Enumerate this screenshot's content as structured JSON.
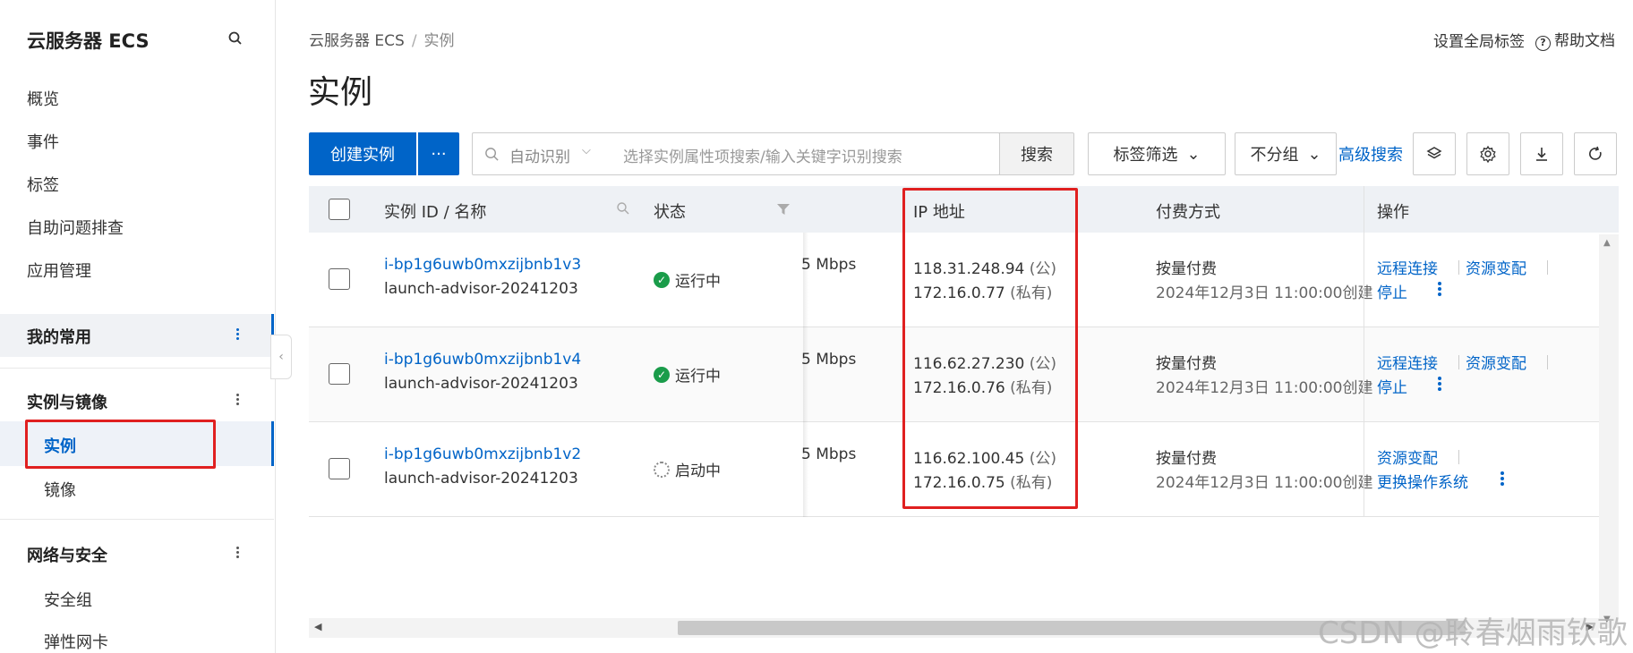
{
  "sidebar": {
    "title": "云服务器 ECS",
    "items": [
      "概览",
      "事件",
      "标签",
      "自助问题排查",
      "应用管理"
    ],
    "favorites_label": "我的常用",
    "group_instances": "实例与镜像",
    "sub_instances": "实例",
    "sub_images": "镜像",
    "group_network": "网络与安全",
    "sub_security_group": "安全组",
    "sub_eni": "弹性网卡"
  },
  "breadcrumb": {
    "root": "云服务器 ECS",
    "sep": "/",
    "current": "实例"
  },
  "topbar": {
    "global_tags": "设置全局标签",
    "help_icon": "?",
    "help": "帮助文档"
  },
  "page_title": "实例",
  "toolbar": {
    "create": "创建实例",
    "more": "···",
    "search_scope": "自动识别",
    "search_scope_chev": "⌵",
    "search_placeholder": "选择实例属性项搜索/输入关键字识别搜索",
    "search_btn": "搜索",
    "tag_filter": "标签筛选",
    "group_select": "不分组",
    "advanced_search": "高级搜索"
  },
  "table": {
    "headers": {
      "id_name": "实例 ID / 名称",
      "status": "状态",
      "ip": "IP 地址",
      "billing": "付费方式",
      "ops": "操作"
    },
    "rows": [
      {
        "id": "i-bp1g6uwb0mxzijbnb1v3",
        "name": "launch-advisor-20241203",
        "status": "运行中",
        "status_icon": "✓",
        "bandwidth": "5 Mbps",
        "ip_public": "118.31.248.94",
        "ip_public_tag": "(公)",
        "ip_private": "172.16.0.77",
        "ip_private_tag": "(私有)",
        "billing": "按量付费",
        "created": "2024年12月3日 11:00:00创建",
        "op1": "远程连接",
        "op2": "资源变配",
        "op3": "停止"
      },
      {
        "id": "i-bp1g6uwb0mxzijbnb1v4",
        "name": "launch-advisor-20241203",
        "status": "运行中",
        "status_icon": "✓",
        "bandwidth": "5 Mbps",
        "ip_public": "116.62.27.230",
        "ip_public_tag": "(公)",
        "ip_private": "172.16.0.76",
        "ip_private_tag": "(私有)",
        "billing": "按量付费",
        "created": "2024年12月3日 11:00:00创建",
        "op1": "远程连接",
        "op2": "资源变配",
        "op3": "停止"
      },
      {
        "id": "i-bp1g6uwb0mxzijbnb1v2",
        "name": "launch-advisor-20241203",
        "status": "启动中",
        "bandwidth": "5 Mbps",
        "ip_public": "116.62.100.45",
        "ip_public_tag": "(公)",
        "ip_private": "172.16.0.75",
        "ip_private_tag": "(私有)",
        "billing": "按量付费",
        "created": "2024年12月3日 11:00:00创建",
        "op1": "资源变配",
        "op2": "更换操作系统"
      }
    ]
  },
  "ui": {
    "collapse_chevron": "‹",
    "scroll_up": "▲",
    "scroll_down": "▼",
    "scroll_left": "◀",
    "scroll_right": "▶",
    "tag_filter_chevron": "⌄",
    "group_select_chevron": "⌄"
  },
  "watermark": "CSDN @聆春烟雨钦歌",
  "colors": {
    "primary": "#0064c8",
    "highlight": "#e02020",
    "running": "#1a9c4a"
  },
  "icons": [
    "search-icon",
    "layers-icon",
    "gear-icon",
    "download-icon",
    "refresh-icon",
    "help-icon",
    "kebab-icon",
    "filter-icon"
  ]
}
